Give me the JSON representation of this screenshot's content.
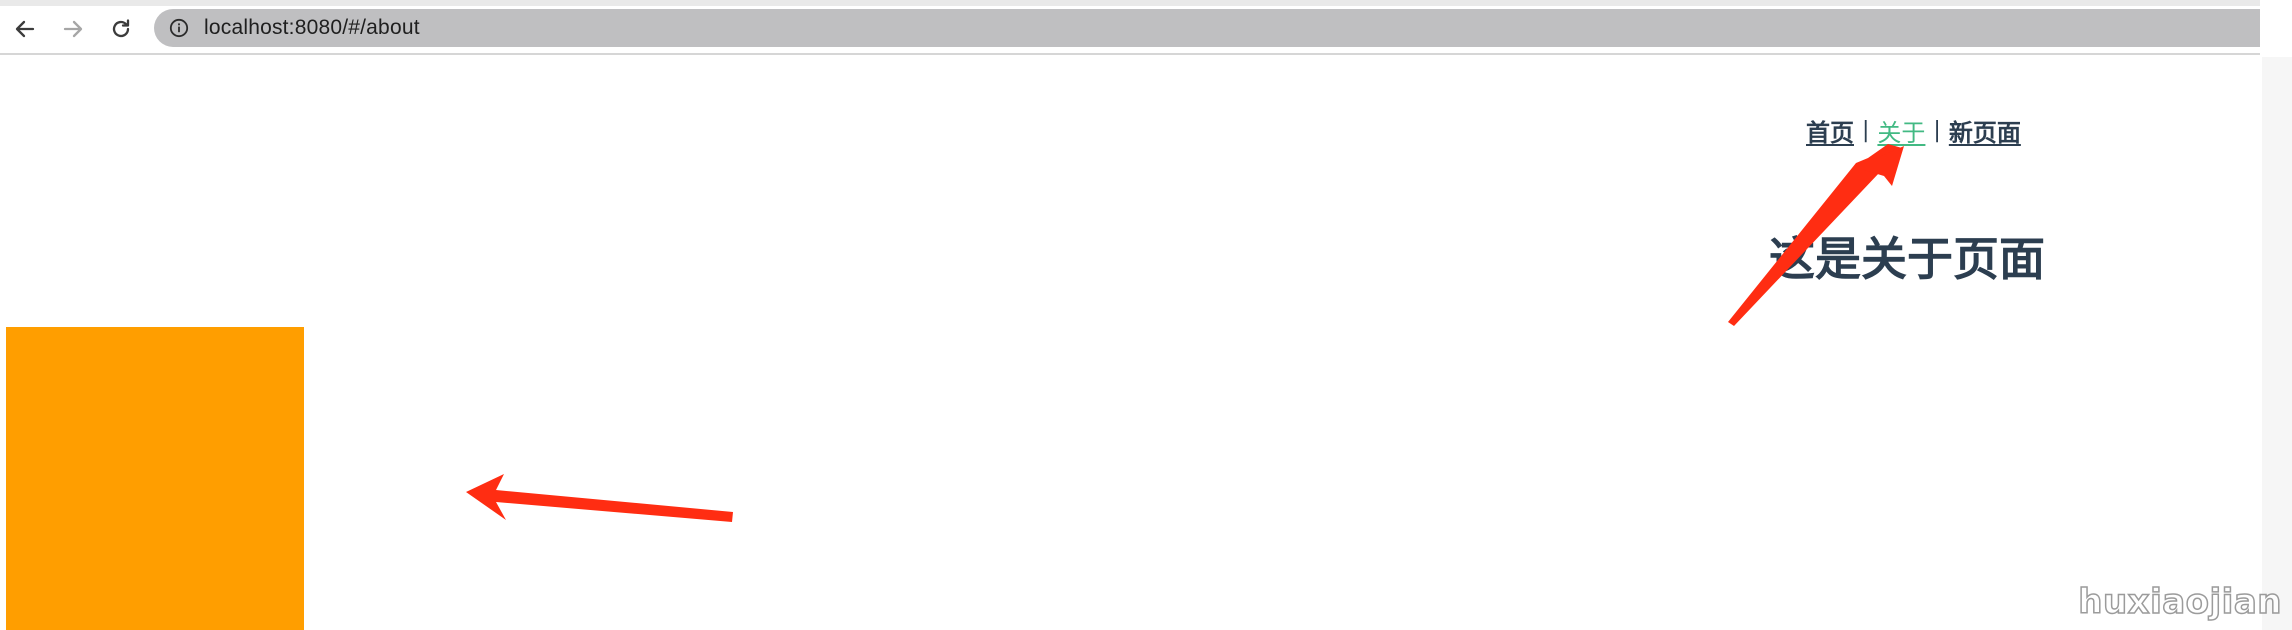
{
  "browser": {
    "url": "localhost:8080/#/about",
    "icons": {
      "back": "arrow-left-icon",
      "forward": "arrow-right-icon",
      "reload": "reload-icon",
      "site_info": "info-icon"
    }
  },
  "nav": {
    "links": [
      {
        "label": "首页",
        "active": false
      },
      {
        "label": "关于",
        "active": true
      },
      {
        "label": "新页面",
        "active": false
      }
    ],
    "separator": "|"
  },
  "main": {
    "heading": "这是关于页面"
  },
  "watermark": "huxiaojian",
  "colors": {
    "text": "#2c3e50",
    "active_link": "#42b983",
    "box": "#ff9e00",
    "arrow": "#ff2d12",
    "omnibox": "#bfbfc1"
  }
}
